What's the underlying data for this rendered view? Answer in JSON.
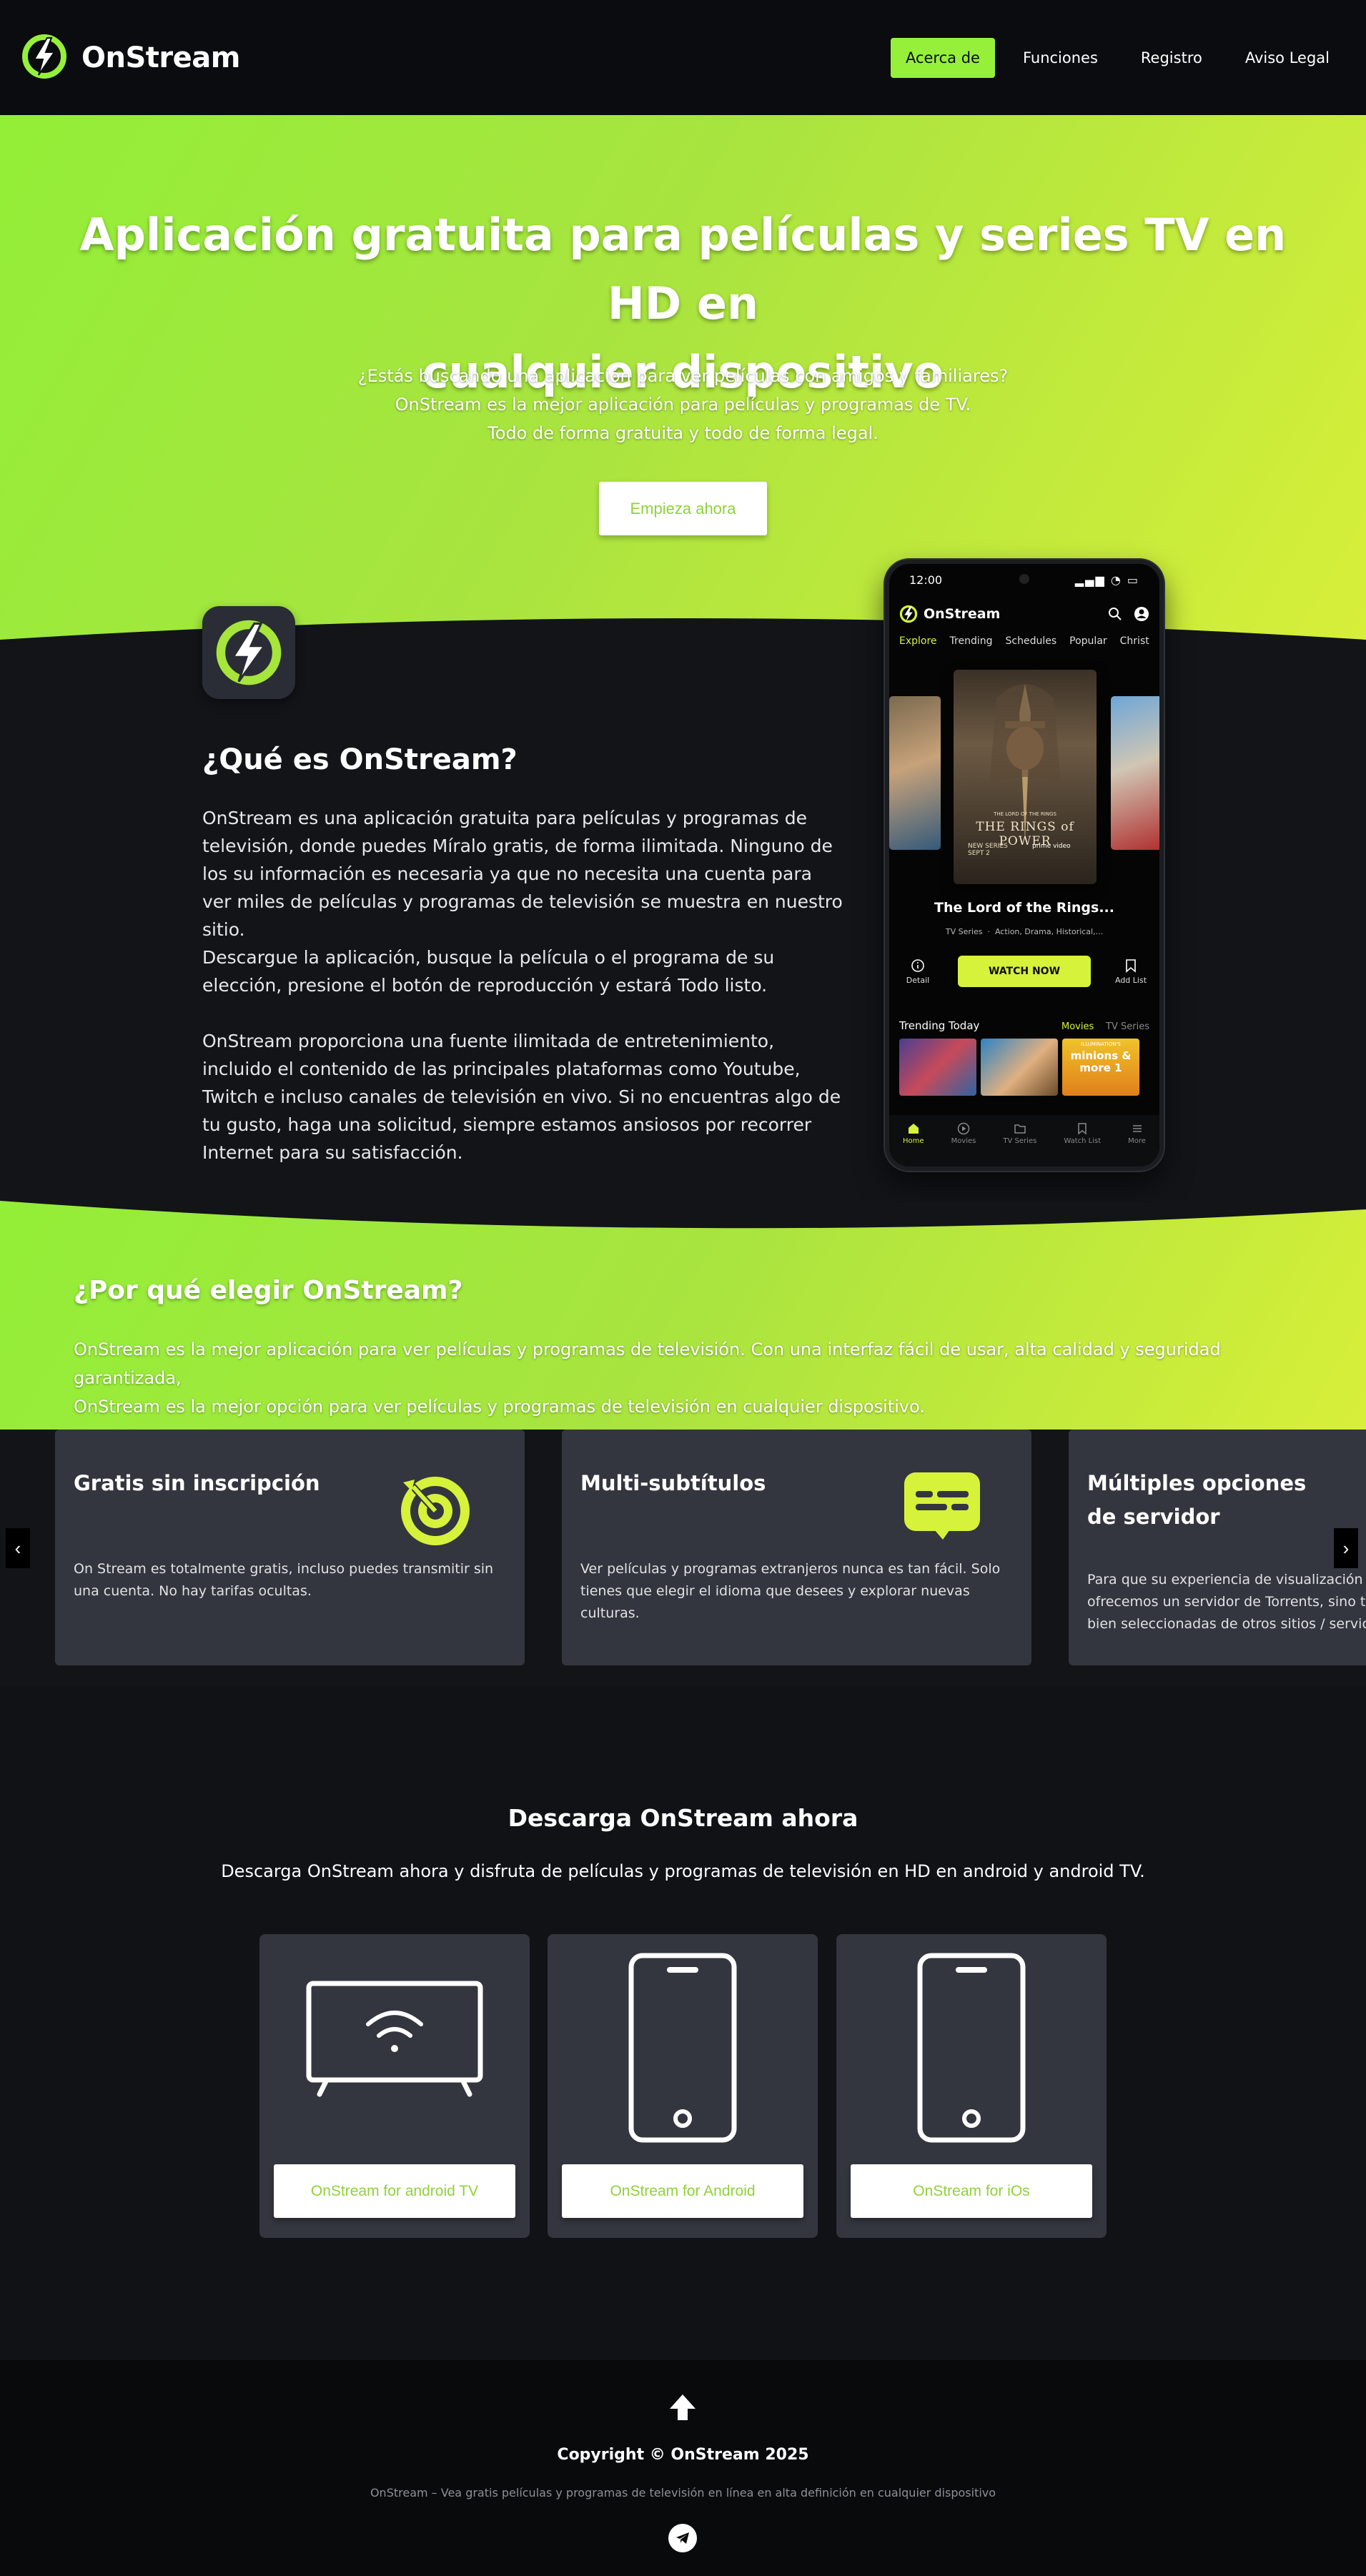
{
  "nav": {
    "brand": "OnStream",
    "items": [
      {
        "label": "Acerca de",
        "active": true
      },
      {
        "label": "Funciones"
      },
      {
        "label": "Registro"
      },
      {
        "label": "Aviso Legal"
      }
    ]
  },
  "hero": {
    "title_line1": "Aplicación gratuita para películas y series TV en HD en",
    "title_line2": "cualquier dispositivo",
    "sub_line1": "¿Estás buscando una aplicación para ver películas con amigos y familiares?",
    "sub_line2": "OnStream es la mejor aplicación para películas y programas de TV.",
    "sub_line3": "Todo de forma gratuita y todo de forma legal.",
    "cta": "Empieza ahora"
  },
  "what": {
    "title": "¿Qué es OnStream?",
    "p1": "OnStream es una aplicación gratuita para películas y programas de televisión, donde puedes Míralo gratis, de forma ilimitada. Ninguno de los su información es necesaria ya que no necesita una cuenta para ver miles de películas y programas de televisión se muestra en nuestro sitio.",
    "p2": "Descargue la aplicación, busque la película o el programa de su elección, presione el botón de reproducción y estará Todo listo.",
    "p3": "OnStream proporciona una fuente ilimitada de entretenimiento, incluido el contenido de las principales plataformas como Youtube, Twitch e incluso canales de televisión en vivo. Si no encuentras algo de tu gusto, haga una solicitud, siempre estamos ansiosos por recorrer Internet para su satisfacción."
  },
  "phone": {
    "time": "12:00",
    "brand": "OnStream",
    "tabs": [
      "Explore",
      "Trending",
      "Schedules",
      "Popular",
      "Christ"
    ],
    "poster_small": "THE LORD OF THE RINGS",
    "poster_title": "THE RINGS of POWER",
    "poster_badge": "NEW SERIES SEPT 2",
    "poster_service": "prime video",
    "title": "The Lord of the Rings...",
    "meta_type": "TV Series",
    "meta_genre": "Action, Drama, Historical,...",
    "detail_label": "Detail",
    "watch_label": "WATCH NOW",
    "addlist_label": "Add List",
    "trending_label": "Trending Today",
    "trending_movies": "Movies",
    "trending_tv": "TV Series",
    "thumb3_text": "minions & more 1",
    "thumb3_brand": "ILLUMINATION'S",
    "bottom_nav": [
      "Home",
      "Movies",
      "TV Series",
      "Watch List",
      "More"
    ]
  },
  "why": {
    "title": "¿Por qué elegir OnStream?",
    "p_line1": "OnStream es la mejor aplicación para ver películas y programas de televisión. Con una interfaz fácil de usar, alta calidad y seguridad garantizada,",
    "p_line2": "OnStream es la mejor opción para ver películas y programas de televisión en cualquier dispositivo.",
    "cards": [
      {
        "title": "Gratis sin inscripción",
        "text_line1": "On Stream es totalmente gratis, incluso puedes transmitir sin",
        "text_line2": "una cuenta. No hay tarifas ocultas.",
        "text_line3": ""
      },
      {
        "title": "Multi-subtítulos",
        "text_line1": "Ver películas y programas extranjeros nunca es tan fácil. Solo",
        "text_line2": "tienes que elegir el idioma que desees y explorar nuevas",
        "text_line3": "culturas."
      },
      {
        "title_line1": "Múltiples opciones",
        "title_line2": "de servidor",
        "text_line1": "Para que su experiencia de visualización sea",
        "text_line2": "ofrecemos un servidor de Torrents, sino ta",
        "text_line3": "bien seleccionadas de otros sitios / servic"
      }
    ],
    "prev": "‹",
    "next": "›"
  },
  "download": {
    "title": "Descarga OnStream ahora",
    "sub": "Descarga OnStream ahora y disfruta de películas y programas de televisión en HD en android y android TV.",
    "buttons": [
      "OnStream for android TV",
      "OnStream for Android",
      "OnStream for iOs"
    ]
  },
  "footer": {
    "copyright": "Copyright © OnStream 2025",
    "desc": "OnStream – Vea gratis películas y programas de televisión en línea en alta definición en cualquier dispositivo"
  },
  "colors": {
    "accent": "#96f03a",
    "accent_yellow": "#d6f23a",
    "dark": "#121418",
    "card": "#33363e"
  }
}
